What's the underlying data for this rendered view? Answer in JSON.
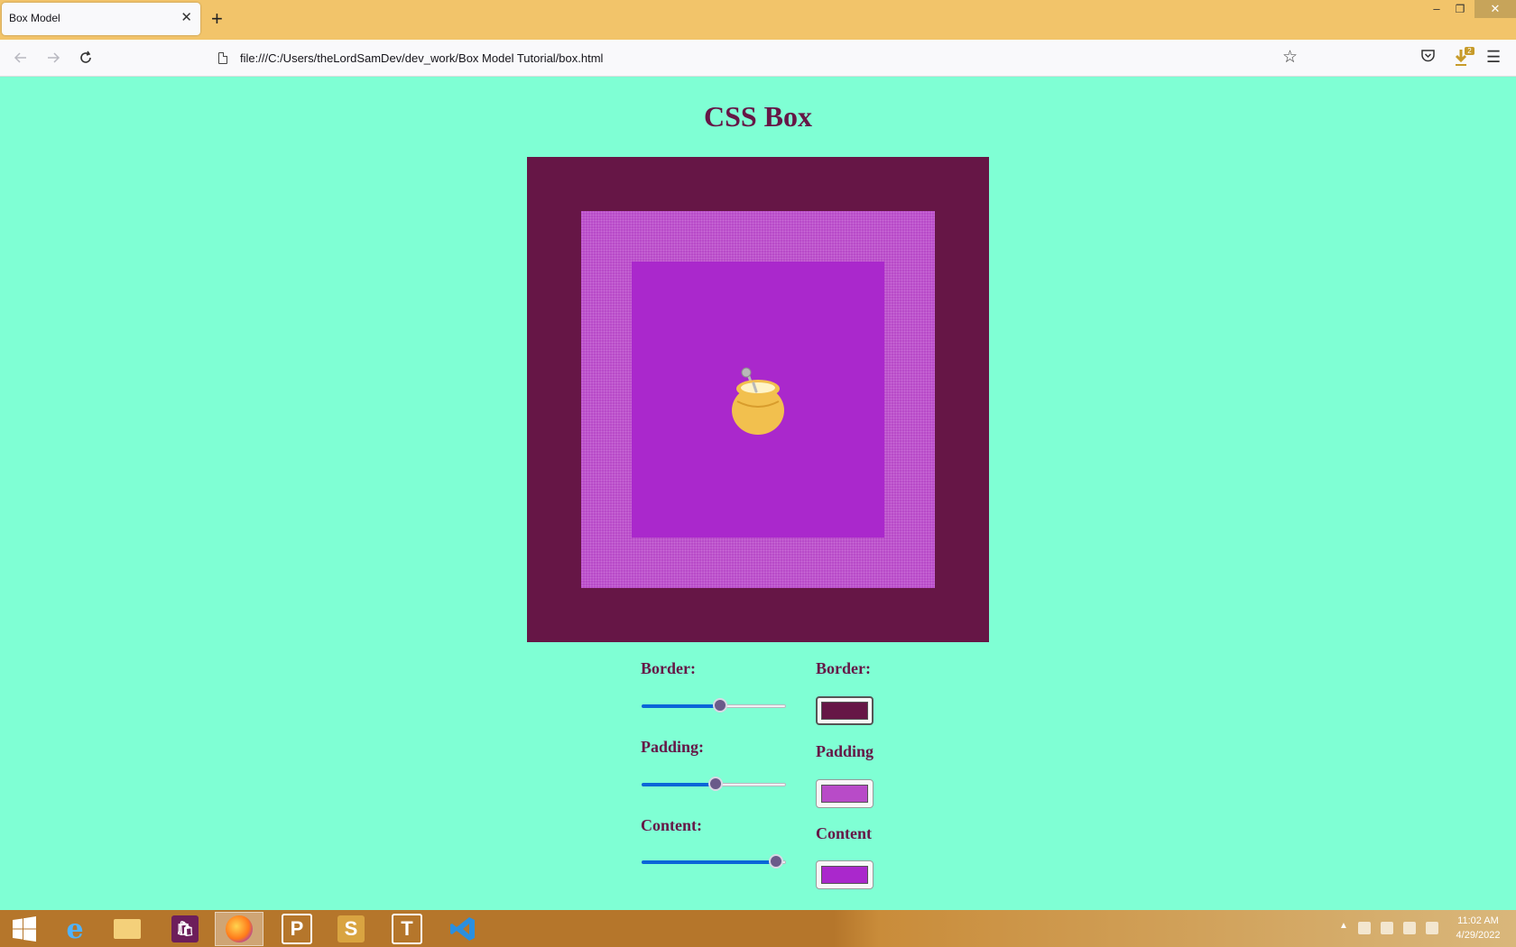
{
  "browser": {
    "tab_title": "Box Model",
    "tab_close": "✕",
    "new_tab": "+",
    "url": "file:///C:/Users/theLordSamDev/dev_work/Box Model Tutorial/box.html",
    "download_badge": "2",
    "window_controls": {
      "minimize": "–",
      "maximize": "❐",
      "close": "✕"
    }
  },
  "page": {
    "title": "CSS Box",
    "colors": {
      "background": "#7fffd4",
      "border": "#661646",
      "padding": "#b84bc8",
      "content": "#aa28cc",
      "heading": "#661646"
    },
    "controls": {
      "border_size_label": "Border:",
      "padding_size_label": "Padding:",
      "content_size_label": "Content:",
      "border_color_label": "Border:",
      "padding_color_label": "Padding",
      "content_color_label": "Content",
      "border_size_value": 0.55,
      "padding_size_value": 0.52,
      "content_size_value": 0.94
    }
  },
  "taskbar": {
    "apps": [
      "start-icon",
      "internet-explorer-icon",
      "file-explorer-icon",
      "store-icon",
      "firefox-icon",
      "app-p-icon",
      "app-s-icon",
      "app-t-icon",
      "vscode-icon"
    ],
    "clock_time": "11:02 AM",
    "clock_date": "4/29/2022"
  }
}
